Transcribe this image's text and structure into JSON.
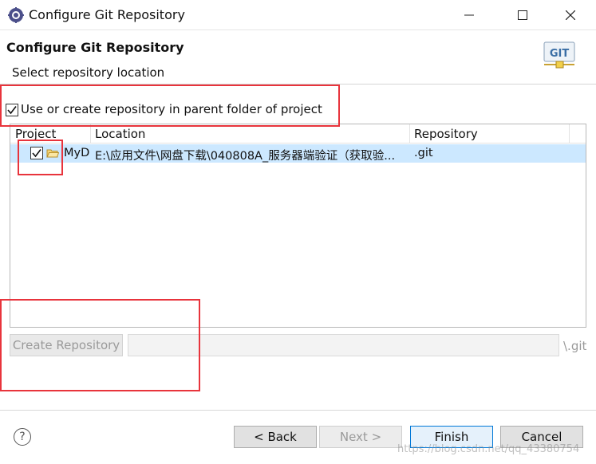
{
  "window": {
    "title": "Configure Git Repository",
    "controls": {
      "minimize": "—",
      "maximize": "☐",
      "close": "✕"
    }
  },
  "header": {
    "title": "Configure Git Repository",
    "description": "Select repository location",
    "logo_text": "GIT"
  },
  "parent_folder_option": {
    "label": "Use or create repository in parent folder of project",
    "checked": true
  },
  "table": {
    "columns": [
      "Project",
      "Location",
      "Repository"
    ],
    "rows": [
      {
        "checked": true,
        "project": "MyD",
        "location": "E:\\应用文件\\网盘下载\\040808A_服务器端验证（获取验...",
        "repository": ".git"
      }
    ]
  },
  "create_repository": {
    "button_label": "Create Repository",
    "path_value": "",
    "suffix": "\\.git"
  },
  "footer": {
    "help": "?",
    "back": "< Back",
    "next": "Next >",
    "finish": "Finish",
    "cancel": "Cancel"
  },
  "watermark": "https://blog.csdn.net/qq_43380754",
  "colors": {
    "selection": "#cce8ff",
    "annotation": "#e8343c",
    "focus_border": "#0078d7"
  }
}
